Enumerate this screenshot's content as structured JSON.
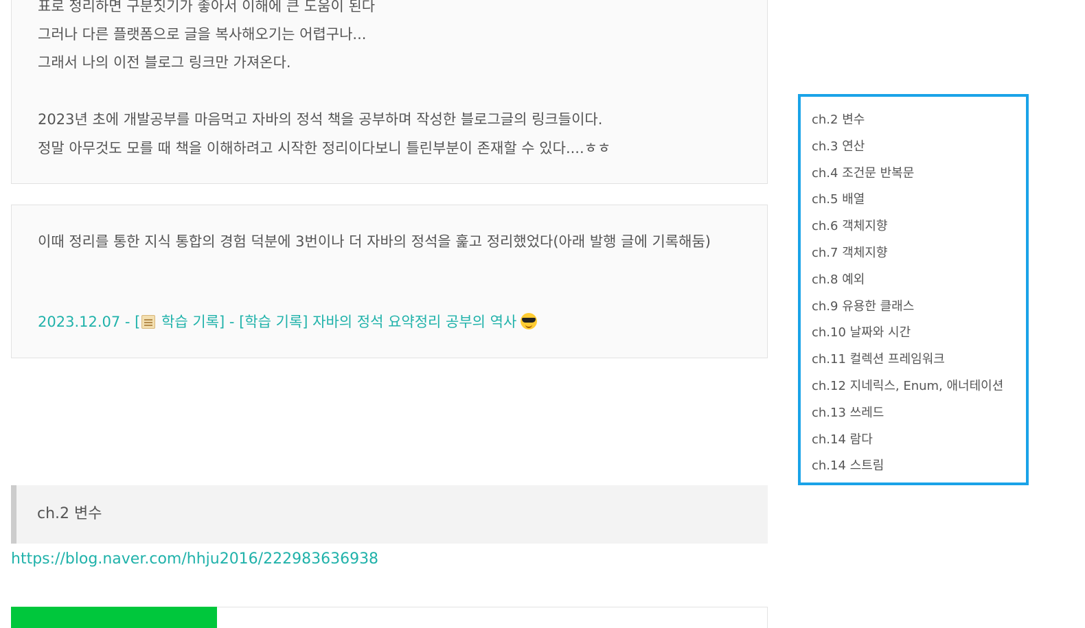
{
  "intro_box": {
    "lines": [
      "표로 정리하면 구분짓기가 좋아서 이해에 큰 도움이 된다",
      "그러나 다른 플랫폼으로 글을 복사해오기는 어렵구나...",
      "그래서 나의 이전 블로그 링크만 가져온다.",
      "2023년 초에 개발공부를 마음먹고 자바의 정석 책을 공부하며 작성한 블로그글의 링크들이다.",
      "정말 아무것도 모를 때 책을 이해하려고 시작한 정리이다보니 틀린부분이 존재할 수 있다....ㅎㅎ"
    ]
  },
  "note_box": {
    "text": "이때 정리를 통한 지식 통합의 경험 덕분에  3번이나 더 자바의 정석을 훑고 정리했었다(아래 발행 글에 기록해둠)",
    "link_prefix": "2023.12.07 - [",
    "link_suffix": " 학습 기록] - [학습 기록] 자바의 정석 요약정리 공부의 역사",
    "link_icon": "scroll-icon",
    "emoji_icon": "cool-sunglasses-icon"
  },
  "section": {
    "heading": "ch.2 변수",
    "url": "https://blog.naver.com/hhju2016/222983636938"
  },
  "toc": {
    "items": [
      "ch.2 변수",
      "ch.3 연산",
      "ch.4 조건문 반복문",
      "ch.5 배열",
      "ch.6 객체지향",
      "ch.7 객체지향",
      "ch.8 예외",
      "ch.9 유용한 클래스",
      "ch.10 날짜와 시간",
      "ch.11 컬렉션 프레임워크",
      "ch.12 지네릭스, Enum, 애너테이션",
      "ch.13 쓰레드",
      "ch.14 람다",
      "ch.14 스트림"
    ],
    "border_color": "#1aa3e8"
  },
  "colors": {
    "link": "#20b2aa",
    "naver_green": "#00c73c",
    "text": "#555555"
  }
}
